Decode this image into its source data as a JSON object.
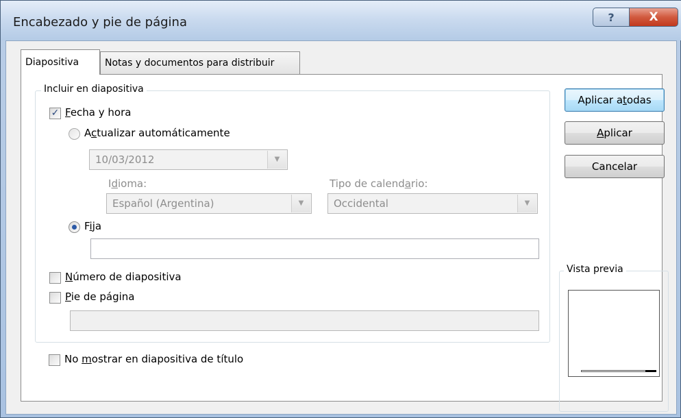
{
  "window": {
    "title": "Encabezado y pie de página",
    "help_label": "?",
    "close_label": "X"
  },
  "tabs": [
    {
      "label": "Diapositiva",
      "active": true
    },
    {
      "label": "Notas y documentos para distribuir",
      "active": false
    }
  ],
  "group_incluir": {
    "title": "Incluir en diapositiva",
    "fecha_hora": {
      "label_first": "F",
      "label_rest": "echa y hora",
      "checked": true
    },
    "actualizar": {
      "label_pre": "A",
      "label_u": "c",
      "label_rest": "tualizar automáticamente",
      "selected": false
    },
    "date_value": "10/03/2012",
    "idioma": {
      "label_pre": "I",
      "label_u": "d",
      "label_rest": "ioma:",
      "value": "Español (Argentina)"
    },
    "calendario": {
      "label_pre": "Tipo de calend",
      "label_u": "a",
      "label_rest": "rio:",
      "value": "Occidental"
    },
    "fija": {
      "label_pre": "F",
      "label_u": "i",
      "label_rest": "ja",
      "selected": true,
      "value": ""
    },
    "numero": {
      "label_u": "N",
      "label_rest": "úmero de diapositiva",
      "checked": false
    },
    "pie": {
      "label_u": "P",
      "label_rest": "ie de página",
      "checked": false,
      "value": ""
    }
  },
  "no_mostrar": {
    "label_pre": "No ",
    "label_u": "m",
    "label_rest": "ostrar en diapositiva de título",
    "checked": false
  },
  "buttons": {
    "aplicar_todas": {
      "pre": "Aplicar a ",
      "u": "t",
      "rest": "odas"
    },
    "aplicar": {
      "u": "A",
      "rest": "plicar"
    },
    "cancelar": "Cancelar"
  },
  "preview": {
    "title": "Vista previa"
  },
  "icons": {
    "check": "✓",
    "arrow": "▼"
  }
}
